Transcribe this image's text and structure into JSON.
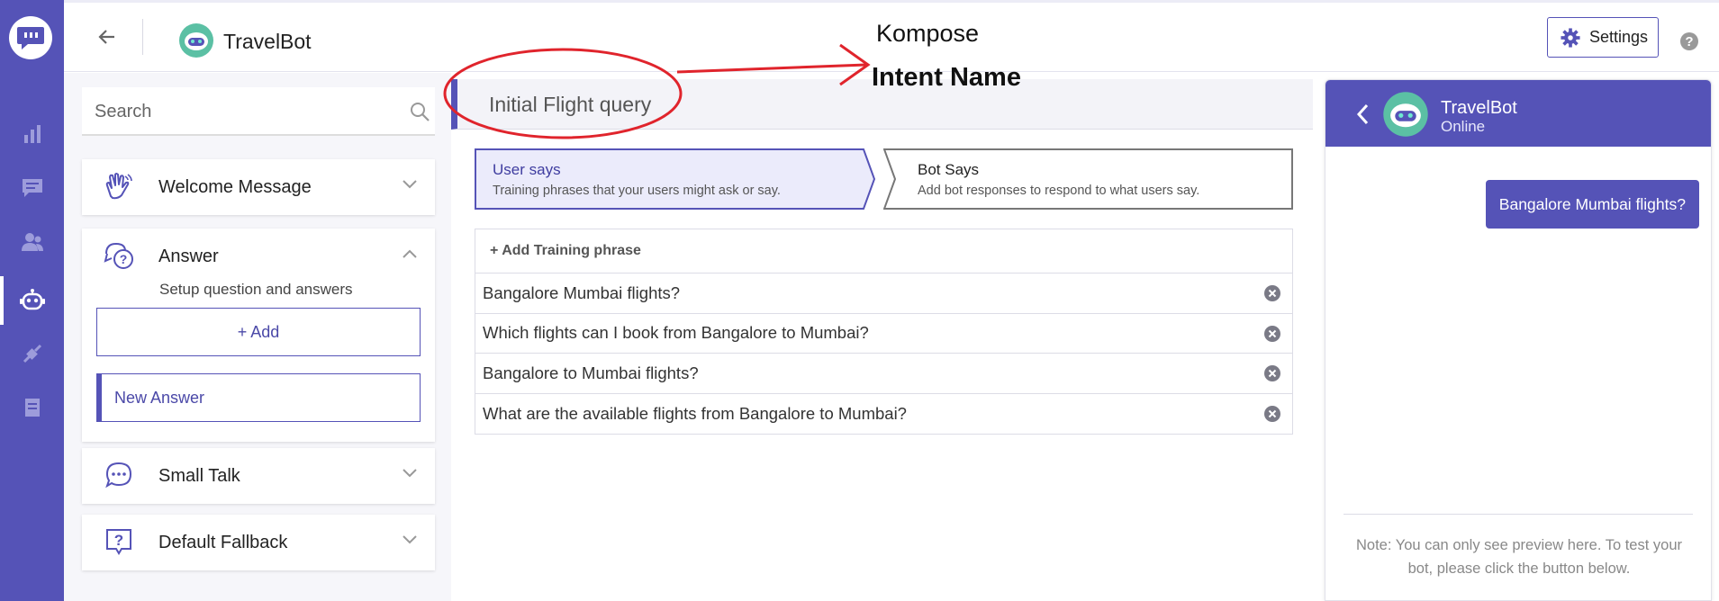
{
  "app": {
    "title": "Kompose",
    "bot_name": "TravelBot"
  },
  "topbar": {
    "settings_label": "Settings"
  },
  "annotation": {
    "label": "Intent Name",
    "color": "#e0242c"
  },
  "colors": {
    "accent": "#5553b7",
    "accent_light": "#ebebfb"
  },
  "rail": {
    "items": [
      "logo-chat-icon",
      "analytics-icon",
      "conversations-icon",
      "users-icon",
      "bot-icon",
      "integrations-icon",
      "docs-icon"
    ],
    "active": "bot-icon"
  },
  "sidebar": {
    "search_placeholder": "Search",
    "sections": [
      {
        "label": "Welcome Message",
        "icon": "wave-hand-icon",
        "expanded": false
      },
      {
        "label": "Answer",
        "icon": "question-chat-icon",
        "expanded": true,
        "subtitle": "Setup question and answers",
        "add_label": "+ Add",
        "items": [
          "New Answer"
        ]
      },
      {
        "label": "Small Talk",
        "icon": "chat-bubble-icon",
        "expanded": false
      },
      {
        "label": "Default Fallback",
        "icon": "question-box-icon",
        "expanded": false
      }
    ]
  },
  "intent": {
    "name": "Initial Flight query"
  },
  "tabs": [
    {
      "title": "User says",
      "description": "Training phrases that your users might ask or say.",
      "active": true
    },
    {
      "title": "Bot Says",
      "description": "Add bot responses to respond to what users say.",
      "active": false
    }
  ],
  "training": {
    "add_label": "+ Add Training phrase",
    "phrases": [
      "Bangalore Mumbai flights?",
      "Which flights can I book from Bangalore to Mumbai?",
      "Bangalore to Mumbai flights?",
      "What are the available flights from Bangalore to Mumbai?"
    ]
  },
  "preview": {
    "bot_name": "TravelBot",
    "status": "Online",
    "message": "Bangalore Mumbai flights?",
    "note": "Note: You can only see preview here. To test your bot, please click the button below."
  }
}
